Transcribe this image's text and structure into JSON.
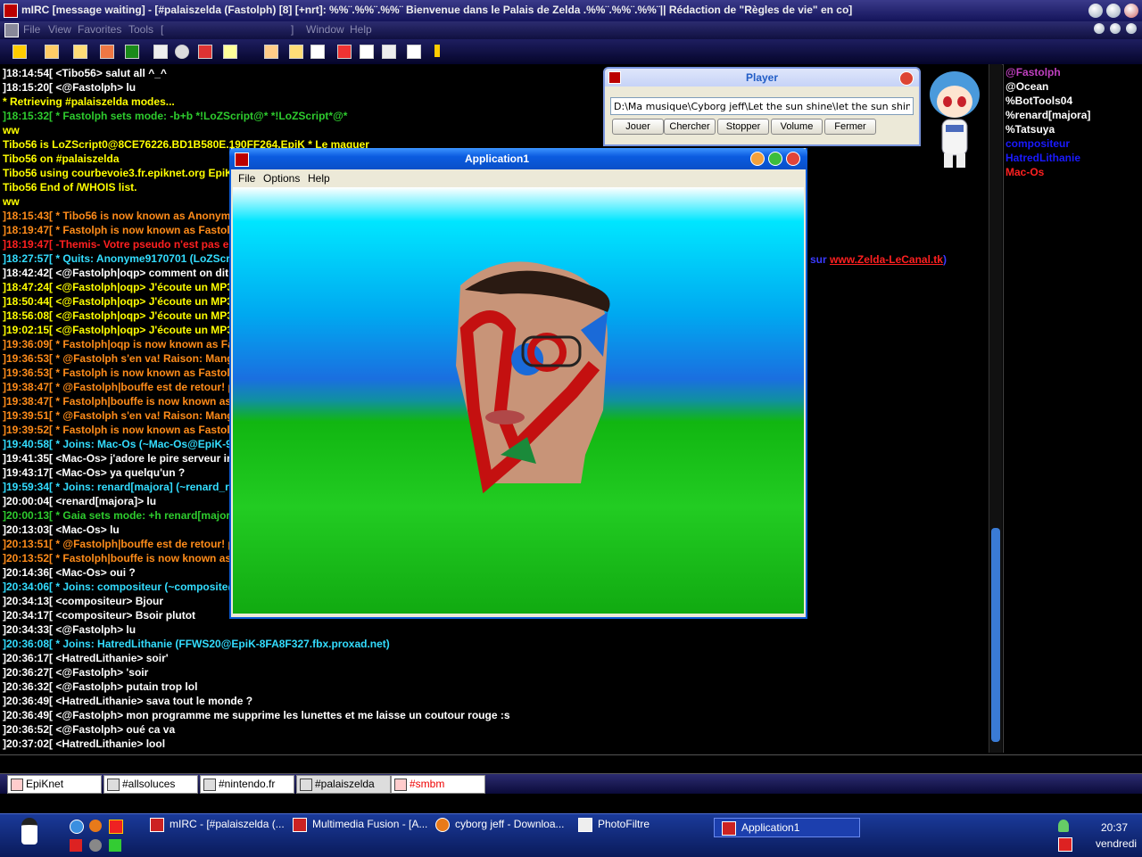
{
  "window": {
    "title": "mIRC [message waiting] - [#palaiszelda (Fastolph) [8] [+nrt]: %%¨.%%¨.%%¨ Bienvenue dans le Palais de Zelda .%%¨.%%¨.%%¨||  Rédaction de \"Règles de vie\" en co]"
  },
  "menu": [
    "File",
    "View",
    "Favorites",
    "Tools",
    "[",
    "]",
    "Window",
    "Help"
  ],
  "chat": {
    "lines": [
      {
        "time": "]18:14:54[",
        "text": " <Tibo56> salut all ^_^",
        "color": "#ffffff"
      },
      {
        "time": "]18:15:20[",
        "text": " <@Fastolph> lu",
        "color": "#ffffff"
      },
      {
        "time": "",
        "text": "* Retrieving #palaiszelda modes...",
        "color": "#ffff00"
      },
      {
        "time": "]18:15:32[",
        "text": " * Fastolph sets mode: -b+b *!LoZScript@* *!LoZScript*@*",
        "color": "#2ecc2e"
      },
      {
        "time": "",
        "text": "ww",
        "color": "#ffff00"
      },
      {
        "time": "",
        "text": "Tibo56 is LoZScript0@8CE76226.BD1B580E.190FF264.EpiK * Le maquer",
        "color": "#ffff00"
      },
      {
        "time": "",
        "text": "Tibo56 on #palaiszelda",
        "color": "#ffff00"
      },
      {
        "time": "",
        "text": "Tibo56 using courbevoie3.fr.epiknet.org EpiK",
        "color": "#ffff00"
      },
      {
        "time": "",
        "text": "Tibo56 End of /WHOIS list.",
        "color": "#ffff00"
      },
      {
        "time": "",
        "text": "ww",
        "color": "#ffff00"
      },
      {
        "time": "]18:15:43[",
        "text": " * Tibo56 is now known as Anonym",
        "color": "#ff8c1a"
      },
      {
        "time": "]18:19:47[",
        "text": " * Fastolph is now known as Fastolp",
        "color": "#ff8c1a"
      },
      {
        "time": "]18:19:47[",
        "text": " -Themis- Votre pseudo n'est pas e",
        "color": "#ff2020"
      },
      {
        "time": "]18:27:57[",
        "text": " * Quits: Anonyme9170701 (LoZScr",
        "color": "#33ddff"
      },
      {
        "time": "]18:42:42[",
        "text": " <@Fastolph|oqp> comment on dit '",
        "color": "#ffffff"
      },
      {
        "time": "]18:47:24[",
        "text": " <@Fastolph|oqp> J'écoute un MP3",
        "color": "#ffff00"
      },
      {
        "time": "]18:50:44[",
        "text": " <@Fastolph|oqp> J'écoute un MP3",
        "color": "#ffff00"
      },
      {
        "time": "]18:56:08[",
        "text": " <@Fastolph|oqp> J'écoute un MP3",
        "color": "#ffff00"
      },
      {
        "time": "]19:02:15[",
        "text": " <@Fastolph|oqp> J'écoute un MP3",
        "color": "#ffff00"
      },
      {
        "time": "]19:36:09[",
        "text": " * Fastolph|oqp is now known as Fa",
        "color": "#ff8c1a"
      },
      {
        "time": "]19:36:53[",
        "text": " * @Fastolph s'en va! Raison: Mang",
        "color": "#ff8c1a"
      },
      {
        "time": "]19:36:53[",
        "text": " * Fastolph is now known as Fastolp",
        "color": "#ff8c1a"
      },
      {
        "time": "]19:38:47[",
        "text": " * @Fastolph|bouffe est de retour! p",
        "color": "#ff8c1a"
      },
      {
        "time": "]19:38:47[",
        "text": " * Fastolph|bouffe is now known as",
        "color": "#ff8c1a"
      },
      {
        "time": "]19:39:51[",
        "text": " * @Fastolph s'en va! Raison: Mang",
        "color": "#ff8c1a"
      },
      {
        "time": "]19:39:52[",
        "text": " * Fastolph is now known as Fastolp",
        "color": "#ff8c1a"
      },
      {
        "time": "]19:40:58[",
        "text": " * Joins: Mac-Os (~Mac-Os@EpiK-9",
        "color": "#33ddff"
      },
      {
        "time": "]19:41:35[",
        "text": " <Mac-Os> j'adore le pire serveur ir",
        "color": "#ffffff"
      },
      {
        "time": "]19:43:17[",
        "text": " <Mac-Os> ya quelqu'un ?",
        "color": "#ffffff"
      },
      {
        "time": "]19:59:34[",
        "text": " * Joins: renard[majora] (~renard_r",
        "color": "#33ddff"
      },
      {
        "time": "]20:00:04[",
        "text": " <renard[majora]> lu",
        "color": "#ffffff"
      },
      {
        "time": "]20:00:13[",
        "text": " * Gaia sets mode: +h renard[major",
        "color": "#2ecc2e"
      },
      {
        "time": "]20:13:03[",
        "text": " <Mac-Os> lu",
        "color": "#ffffff"
      },
      {
        "time": "]20:13:51[",
        "text": " * @Fastolph|bouffe est de retour! p",
        "color": "#ff8c1a"
      },
      {
        "time": "]20:13:52[",
        "text": " * Fastolph|bouffe is now known as",
        "color": "#ff8c1a"
      },
      {
        "time": "]20:14:36[",
        "text": " <Mac-Os> oui ?",
        "color": "#ffffff"
      },
      {
        "time": "]20:34:06[",
        "text": " * Joins: compositeur (~composite@",
        "color": "#33ddff"
      },
      {
        "time": "]20:34:13[",
        "text": " <compositeur> Bjour",
        "color": "#ffffff"
      },
      {
        "time": "]20:34:17[",
        "text": " <compositeur> Bsoir plutot",
        "color": "#ffffff"
      },
      {
        "time": "]20:34:33[",
        "text": " <@Fastolph> lu",
        "color": "#ffffff"
      },
      {
        "time": "]20:36:08[",
        "text": " * Joins: HatredLithanie (FFWS20@EpiK-8FA8F327.fbx.proxad.net)",
        "color": "#33ddff"
      },
      {
        "time": "]20:36:17[",
        "text": " <HatredLithanie> soir'",
        "color": "#ffffff"
      },
      {
        "time": "]20:36:27[",
        "text": " <@Fastolph> 'soir",
        "color": "#ffffff"
      },
      {
        "time": "]20:36:32[",
        "text": " <@Fastolph> putain trop lol",
        "color": "#ffffff"
      },
      {
        "time": "]20:36:49[",
        "text": " <HatredLithanie> sava tout le monde ?",
        "color": "#ffffff"
      },
      {
        "time": "]20:36:49[",
        "text": " <@Fastolph> mon programme me supprime les lunettes et me laisse un coutour rouge :s",
        "color": "#ffffff"
      },
      {
        "time": "]20:36:52[",
        "text": " <@Fastolph> oué ca va",
        "color": "#ffffff"
      },
      {
        "time": "]20:37:02[",
        "text": " <HatredLithanie> lool",
        "color": "#ffffff"
      }
    ],
    "fragment": "sur",
    "link": "www.Zelda-LeCanal.tk",
    "fragment_end": ")"
  },
  "nicklist": [
    {
      "name": "@Fastolph",
      "color": "#c040c0"
    },
    {
      "name": "@Ocean",
      "color": "#ffffff"
    },
    {
      "name": "%BotTools04",
      "color": "#ffffff"
    },
    {
      "name": "%renard[majora]",
      "color": "#ffffff"
    },
    {
      "name": "%Tatsuya",
      "color": "#ffffff"
    },
    {
      "name": "compositeur",
      "color": "#1a1aff"
    },
    {
      "name": "HatredLithanie",
      "color": "#1a1aff"
    },
    {
      "name": "Mac-Os",
      "color": "#ff2020"
    }
  ],
  "player": {
    "title": "Player",
    "path": "D:\\Ma musique\\Cyborg jeff\\Let the sun shine\\let the sun shine (mart",
    "buttons": [
      "Jouer",
      "Chercher",
      "Stopper",
      "Volume",
      "Fermer"
    ]
  },
  "app": {
    "title": "Application1",
    "menu": [
      "File",
      "Options",
      "Help"
    ]
  },
  "switchbar": [
    "EpiKnet",
    "#allsoluces",
    "#nintendo.fr",
    "#palaiszelda",
    "#smbm"
  ],
  "taskbar": {
    "tasks": [
      "mIRC - [#palaiszelda (...",
      "Multimedia Fusion - [A...",
      "cyborg jeff - Downloa...",
      "PhotoFiltre",
      "Application1"
    ],
    "clock": "20:37",
    "day": "vendredi"
  }
}
